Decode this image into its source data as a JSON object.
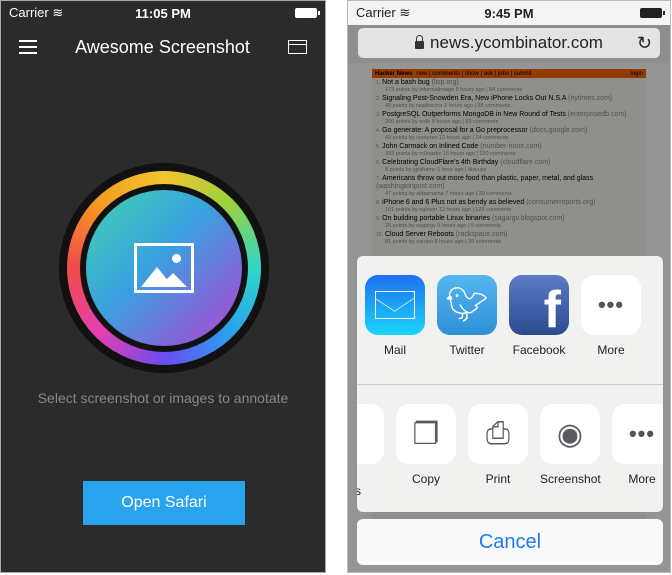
{
  "left": {
    "status": {
      "carrier": "Carrier",
      "time": "11:05 PM"
    },
    "title": "Awesome Screenshot",
    "hint": "Select screenshot or images to annotate",
    "open_button": "Open Safari",
    "accent": "#2aa3ef"
  },
  "right": {
    "status": {
      "carrier": "Carrier",
      "time": "9:45 PM"
    },
    "url": "news.ycombinator.com",
    "hn": {
      "brand": "Hacker News",
      "nav": "new | comments | show | ask | jobs | submit",
      "login": "login",
      "items": [
        {
          "n": "1.",
          "title": "Not a bash bug",
          "domain": "(lisp.org)",
          "sub": "173 points by informatimago 5 hours ago | 84 comments"
        },
        {
          "n": "2.",
          "title": "Signaling Post-Snowden Era, New iPhone Locks Out N.S.A",
          "domain": "(nytimes.com)",
          "sub": "49 points by readirector 3 hours ago | 38 comments"
        },
        {
          "n": "3.",
          "title": "PostgreSQL Outperforms MongoDB in New Round of Tests",
          "domain": "(enterprisedb.com)",
          "sub": "200 points by wslh 9 hours ago | 93 comments"
        },
        {
          "n": "4.",
          "title": "Go generate: A proposal for a Go preprocessor",
          "domain": "(docs.google.com)",
          "sub": "49 points by cpeterso 12 hours ago | 24 comments"
        },
        {
          "n": "5.",
          "title": "John Carmack on Inlined Code",
          "domain": "(number-none.com)",
          "sub": "393 points by m0nastic 18 hours ago | 220 comments"
        },
        {
          "n": "6.",
          "title": "Celebrating CloudFlare's 4th Birthday",
          "domain": "(cloudflare.com)",
          "sub": "8 points by jgrahamc 1 hour ago | discuss"
        },
        {
          "n": "7.",
          "title": "Americans throw out more food than plastic, paper, metal, and glass",
          "domain": "(washingtonpost.com)",
          "sub": "47 points by akbarnama 7 hours ago | 39 comments"
        },
        {
          "n": "8.",
          "title": "iPhone 6 and 6 Plus not as bendy as believed",
          "domain": "(consumerreports.org)",
          "sub": "181 points by eglover 12 hours ago | 125 comments"
        },
        {
          "n": "9.",
          "title": "On building portable Linux binaries",
          "domain": "(sagargv.blogspot.com)",
          "sub": "26 points by sagargv 5 hours ago | 5 comments"
        },
        {
          "n": "10.",
          "title": "Cloud Server Reboots",
          "domain": "(rackspace.com)",
          "sub": "81 points by saropo 8 hours ago | 29 comments"
        }
      ]
    },
    "share_row": [
      {
        "label": "Mail",
        "icon": "mail-icon"
      },
      {
        "label": "Twitter",
        "icon": "twitter-icon"
      },
      {
        "label": "Facebook",
        "icon": "facebook-icon"
      },
      {
        "label": "More",
        "icon": "more-icon"
      }
    ],
    "action_row": [
      {
        "label": "Copy",
        "icon": "copy-icon"
      },
      {
        "label": "Print",
        "icon": "print-icon"
      },
      {
        "label": "Screenshot",
        "icon": "screenshot-icon"
      },
      {
        "label": "More",
        "icon": "more-icon"
      }
    ],
    "partial_label": "ks",
    "cancel": "Cancel",
    "accent": "#1a7cf0"
  }
}
